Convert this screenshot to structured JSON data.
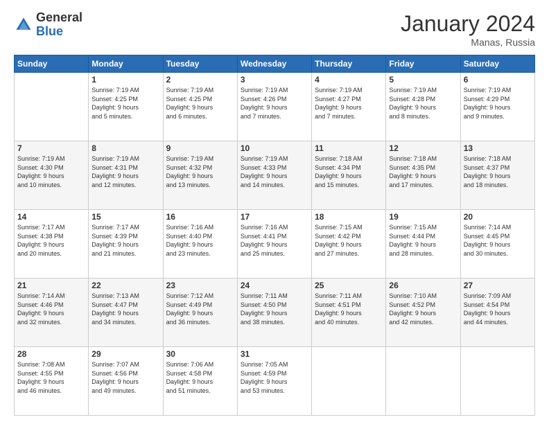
{
  "logo": {
    "general": "General",
    "blue": "Blue"
  },
  "header": {
    "month": "January 2024",
    "location": "Manas, Russia"
  },
  "days_of_week": [
    "Sunday",
    "Monday",
    "Tuesday",
    "Wednesday",
    "Thursday",
    "Friday",
    "Saturday"
  ],
  "weeks": [
    [
      {
        "day": "",
        "info": ""
      },
      {
        "day": "1",
        "info": "Sunrise: 7:19 AM\nSunset: 4:25 PM\nDaylight: 9 hours\nand 5 minutes."
      },
      {
        "day": "2",
        "info": "Sunrise: 7:19 AM\nSunset: 4:25 PM\nDaylight: 9 hours\nand 6 minutes."
      },
      {
        "day": "3",
        "info": "Sunrise: 7:19 AM\nSunset: 4:26 PM\nDaylight: 9 hours\nand 7 minutes."
      },
      {
        "day": "4",
        "info": "Sunrise: 7:19 AM\nSunset: 4:27 PM\nDaylight: 9 hours\nand 7 minutes."
      },
      {
        "day": "5",
        "info": "Sunrise: 7:19 AM\nSunset: 4:28 PM\nDaylight: 9 hours\nand 8 minutes."
      },
      {
        "day": "6",
        "info": "Sunrise: 7:19 AM\nSunset: 4:29 PM\nDaylight: 9 hours\nand 9 minutes."
      }
    ],
    [
      {
        "day": "7",
        "info": ""
      },
      {
        "day": "8",
        "info": "Sunrise: 7:19 AM\nSunset: 4:31 PM\nDaylight: 9 hours\nand 12 minutes."
      },
      {
        "day": "9",
        "info": "Sunrise: 7:19 AM\nSunset: 4:32 PM\nDaylight: 9 hours\nand 13 minutes."
      },
      {
        "day": "10",
        "info": "Sunrise: 7:19 AM\nSunset: 4:33 PM\nDaylight: 9 hours\nand 14 minutes."
      },
      {
        "day": "11",
        "info": "Sunrise: 7:18 AM\nSunset: 4:34 PM\nDaylight: 9 hours\nand 15 minutes."
      },
      {
        "day": "12",
        "info": "Sunrise: 7:18 AM\nSunset: 4:35 PM\nDaylight: 9 hours\nand 17 minutes."
      },
      {
        "day": "13",
        "info": "Sunrise: 7:18 AM\nSunset: 4:37 PM\nDaylight: 9 hours\nand 18 minutes."
      }
    ],
    [
      {
        "day": "14",
        "info": ""
      },
      {
        "day": "15",
        "info": "Sunrise: 7:17 AM\nSunset: 4:39 PM\nDaylight: 9 hours\nand 21 minutes."
      },
      {
        "day": "16",
        "info": "Sunrise: 7:16 AM\nSunset: 4:40 PM\nDaylight: 9 hours\nand 23 minutes."
      },
      {
        "day": "17",
        "info": "Sunrise: 7:16 AM\nSunset: 4:41 PM\nDaylight: 9 hours\nand 25 minutes."
      },
      {
        "day": "18",
        "info": "Sunrise: 7:15 AM\nSunset: 4:42 PM\nDaylight: 9 hours\nand 27 minutes."
      },
      {
        "day": "19",
        "info": "Sunrise: 7:15 AM\nSunset: 4:44 PM\nDaylight: 9 hours\nand 28 minutes."
      },
      {
        "day": "20",
        "info": "Sunrise: 7:14 AM\nSunset: 4:45 PM\nDaylight: 9 hours\nand 30 minutes."
      }
    ],
    [
      {
        "day": "21",
        "info": "Sunrise: 7:14 AM\nSunset: 4:46 PM\nDaylight: 9 hours\nand 32 minutes."
      },
      {
        "day": "22",
        "info": "Sunrise: 7:13 AM\nSunset: 4:47 PM\nDaylight: 9 hours\nand 34 minutes."
      },
      {
        "day": "23",
        "info": "Sunrise: 7:12 AM\nSunset: 4:49 PM\nDaylight: 9 hours\nand 36 minutes."
      },
      {
        "day": "24",
        "info": "Sunrise: 7:11 AM\nSunset: 4:50 PM\nDaylight: 9 hours\nand 38 minutes."
      },
      {
        "day": "25",
        "info": "Sunrise: 7:11 AM\nSunset: 4:51 PM\nDaylight: 9 hours\nand 40 minutes."
      },
      {
        "day": "26",
        "info": "Sunrise: 7:10 AM\nSunset: 4:52 PM\nDaylight: 9 hours\nand 42 minutes."
      },
      {
        "day": "27",
        "info": "Sunrise: 7:09 AM\nSunset: 4:54 PM\nDaylight: 9 hours\nand 44 minutes."
      }
    ],
    [
      {
        "day": "28",
        "info": "Sunrise: 7:08 AM\nSunset: 4:55 PM\nDaylight: 9 hours\nand 46 minutes."
      },
      {
        "day": "29",
        "info": "Sunrise: 7:07 AM\nSunset: 4:56 PM\nDaylight: 9 hours\nand 49 minutes."
      },
      {
        "day": "30",
        "info": "Sunrise: 7:06 AM\nSunset: 4:58 PM\nDaylight: 9 hours\nand 51 minutes."
      },
      {
        "day": "31",
        "info": "Sunrise: 7:05 AM\nSunset: 4:59 PM\nDaylight: 9 hours\nand 53 minutes."
      },
      {
        "day": "",
        "info": ""
      },
      {
        "day": "",
        "info": ""
      },
      {
        "day": "",
        "info": ""
      }
    ]
  ],
  "week1_sun_info": "Sunrise: 7:19 AM\nSunset: 4:30 PM\nDaylight: 9 hours\nand 10 minutes.",
  "week2_sun_info": "Sunrise: 7:17 AM\nSunset: 4:38 PM\nDaylight: 9 hours\nand 20 minutes."
}
